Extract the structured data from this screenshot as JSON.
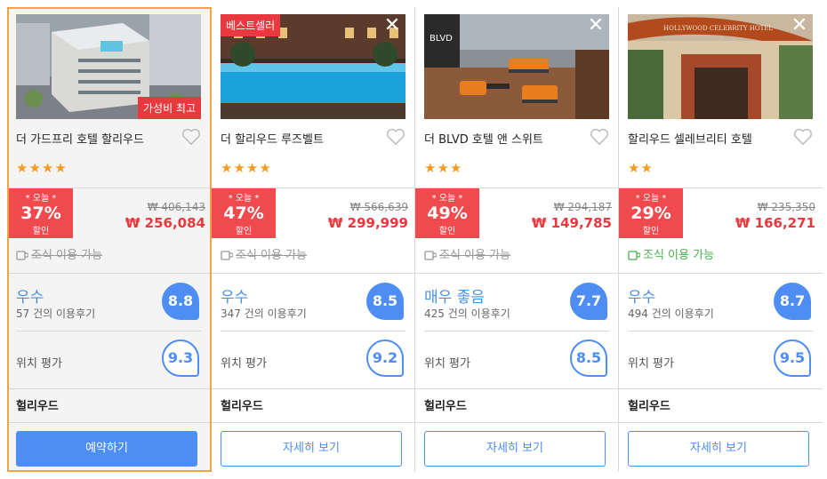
{
  "hotels": [
    {
      "name": "더 가드프리 호텔 할리우드",
      "best_badge": "",
      "value_badge": "가성비 최고",
      "show_close": false,
      "stars": "★★★★",
      "today_label": "* 오늘 *",
      "discount": "37%",
      "discount_suffix": "할인",
      "original_price": "₩ 406,143",
      "price": "₩ 256,084",
      "breakfast": "조식 이용 가능",
      "breakfast_available": false,
      "rating_word": "우수",
      "reviews": "57 건의 이용후기",
      "score": "8.8",
      "location_label": "위치 평가",
      "location_score": "9.3",
      "area": "헐리우드",
      "button": "예약하기"
    },
    {
      "name": "더 할리우드 루즈벨트",
      "best_badge": "베스트셀러",
      "value_badge": "",
      "show_close": true,
      "stars": "★★★★",
      "today_label": "* 오늘 *",
      "discount": "47%",
      "discount_suffix": "할인",
      "original_price": "₩ 566,639",
      "price": "₩ 299,999",
      "breakfast": "조식 이용 가능",
      "breakfast_available": false,
      "rating_word": "우수",
      "reviews": "347 건의 이용후기",
      "score": "8.5",
      "location_label": "위치 평가",
      "location_score": "9.2",
      "area": "헐리우드",
      "button": "자세히 보기"
    },
    {
      "name": "더 BLVD 호텔 앤 스위트",
      "best_badge": "",
      "value_badge": "",
      "show_close": true,
      "stars": "★★★",
      "today_label": "* 오늘 *",
      "discount": "49%",
      "discount_suffix": "할인",
      "original_price": "₩ 294,187",
      "price": "₩ 149,785",
      "breakfast": "조식 이용 가능",
      "breakfast_available": false,
      "rating_word": "매우 좋음",
      "reviews": "425 건의 이용후기",
      "score": "7.7",
      "location_label": "위치 평가",
      "location_score": "8.5",
      "area": "헐리우드",
      "button": "자세히 보기"
    },
    {
      "name": "할리우드 셀레브리티 호텔",
      "best_badge": "",
      "value_badge": "",
      "show_close": true,
      "stars": "★★",
      "today_label": "* 오늘 *",
      "discount": "29%",
      "discount_suffix": "할인",
      "original_price": "₩ 235,350",
      "price": "₩ 166,271",
      "breakfast": "조식 이용 가능",
      "breakfast_available": true,
      "rating_word": "우수",
      "reviews": "494 건의 이용후기",
      "score": "8.7",
      "location_label": "위치 평가",
      "location_score": "9.5",
      "area": "헐리우드",
      "button": "자세히 보기"
    }
  ],
  "photo_signs": {
    "hotel3_logo": "BLVD",
    "hotel4_sign": "HOLLYWOOD CELEBRITY HOTEL"
  },
  "colors": {
    "accent_blue": "#4d8df4",
    "discount_red": "#ef4a4e",
    "star_orange": "#f59b1f",
    "selected_border": "#f5a146",
    "breakfast_green": "#4caf50"
  }
}
